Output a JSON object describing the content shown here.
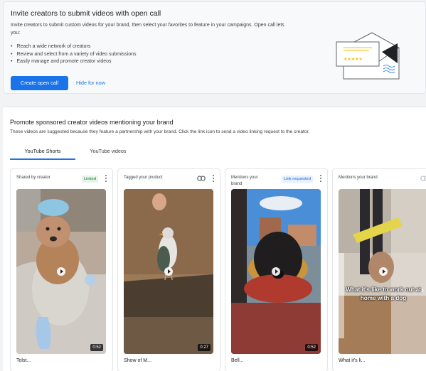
{
  "open_call": {
    "title": "Invite creators to submit videos with open call",
    "description": "Invite creators to submit custom videos for your brand, then select your favorites to feature in your campaigns. Open call lets you:",
    "bullets": [
      "Reach a wide network of creators",
      "Review and select from a variety of video submissions",
      "Easily manage and promote creator videos"
    ],
    "primary_button": "Create open call",
    "secondary_link": "Hide for now",
    "illustration_icon": "envelope-icon"
  },
  "promote": {
    "title": "Promote sponsored creator videos mentioning your brand",
    "description": "These videos are suggested because they feature a partnership with your brand. Click the link icon to send a video linking request to the creator.",
    "tabs": [
      {
        "label": "YouTube Shorts",
        "active": true
      },
      {
        "label": "YouTube videos",
        "active": false
      }
    ],
    "cards": [
      {
        "header": "Shared by creator",
        "badge": "Linked",
        "duration": "0:52",
        "caption": "Tolst..."
      },
      {
        "header": "Tagged your product",
        "badge": "",
        "duration": "0:27",
        "caption": "Show of M..."
      },
      {
        "header": "Mentions your brand",
        "badge": "Link requested",
        "duration": "0:52",
        "caption": "Bell..."
      },
      {
        "header": "Mentions your brand",
        "badge": "",
        "duration": "",
        "caption": "What it's li...",
        "overlay_text": "What it's like to work out at home with a dog"
      }
    ]
  },
  "colors": {
    "accent": "#1a73e8",
    "linked_badge_bg": "#e6f4ea",
    "linked_badge_text": "#137333",
    "requested_badge_bg": "#e8f0fe",
    "requested_badge_text": "#1967d2"
  }
}
